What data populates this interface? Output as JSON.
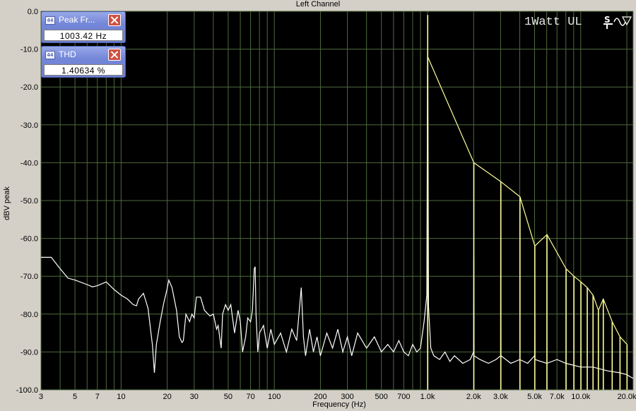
{
  "chart_data": {
    "type": "line",
    "title": "Left Channel",
    "xlabel": "Frequency (Hz)",
    "ylabel": "dBV peak",
    "x_scale": "log",
    "xlim": [
      3,
      22000
    ],
    "ylim": [
      -100,
      0
    ],
    "y_ticks": [
      0,
      -10,
      -20,
      -30,
      -40,
      -50,
      -60,
      -70,
      -80,
      -90,
      -100
    ],
    "y_tick_labels": [
      "0.0",
      "-10.0",
      "-20.0",
      "-30.0",
      "-40.0",
      "-50.0",
      "-60.0",
      "-70.0",
      "-80.0",
      "-90.0",
      "-100.0"
    ],
    "x_ticks": [
      3,
      5,
      7,
      10,
      20,
      30,
      50,
      70,
      100,
      200,
      300,
      500,
      700,
      1000,
      2000,
      3000,
      5000,
      7000,
      10000,
      20000
    ],
    "x_tick_labels": [
      "3",
      "5",
      "7",
      "10",
      "20",
      "30",
      "50",
      "70",
      "100",
      "200",
      "300",
      "500",
      "700",
      "1.0k",
      "2.0k",
      "3.0k",
      "5.0k",
      "7.0k",
      "10.0k",
      "20.0k"
    ],
    "grid": true,
    "series": [
      {
        "color": "#ffffff",
        "points": [
          [
            3,
            -65
          ],
          [
            3.5,
            -65
          ],
          [
            4,
            -68
          ],
          [
            4.5,
            -70.5
          ],
          [
            5,
            -71
          ],
          [
            6,
            -72.2
          ],
          [
            6.5,
            -72.8
          ],
          [
            7,
            -72.5
          ],
          [
            8,
            -71.5
          ],
          [
            9,
            -73.5
          ],
          [
            10,
            -75
          ],
          [
            11,
            -76
          ],
          [
            12,
            -77.5
          ],
          [
            12.6,
            -77.8
          ],
          [
            13,
            -76
          ],
          [
            14,
            -74.5
          ],
          [
            14.5,
            -76.5
          ],
          [
            15,
            -78.5
          ],
          [
            16,
            -88
          ],
          [
            16.5,
            -95.5
          ],
          [
            17,
            -88
          ],
          [
            18,
            -82
          ],
          [
            19,
            -77
          ],
          [
            19.8,
            -74
          ],
          [
            20.5,
            -71
          ],
          [
            21.5,
            -73
          ],
          [
            23,
            -79
          ],
          [
            24,
            -86
          ],
          [
            25,
            -87.5
          ],
          [
            25.5,
            -87
          ],
          [
            26.5,
            -80
          ],
          [
            28,
            -82
          ],
          [
            29,
            -80
          ],
          [
            30,
            -81
          ],
          [
            31,
            -75.5
          ],
          [
            33,
            -75.5
          ],
          [
            35,
            -79
          ],
          [
            38,
            -80.5
          ],
          [
            40,
            -80
          ],
          [
            42,
            -84
          ],
          [
            43,
            -83
          ],
          [
            45,
            -89
          ],
          [
            46,
            -80
          ],
          [
            48,
            -77.5
          ],
          [
            50,
            -79
          ],
          [
            52,
            -77.5
          ],
          [
            55,
            -85
          ],
          [
            58,
            -79
          ],
          [
            60,
            -82
          ],
          [
            62,
            -90
          ],
          [
            65,
            -86
          ],
          [
            67,
            -81
          ],
          [
            70,
            -82
          ],
          [
            72,
            -79
          ],
          [
            74,
            -68
          ],
          [
            75,
            -67.5
          ],
          [
            76,
            -80
          ],
          [
            78,
            -90
          ],
          [
            80,
            -85
          ],
          [
            85,
            -83
          ],
          [
            90,
            -89
          ],
          [
            95,
            -84
          ],
          [
            100,
            -88
          ],
          [
            110,
            -85
          ],
          [
            120,
            -90
          ],
          [
            130,
            -84
          ],
          [
            140,
            -87
          ],
          [
            150,
            -73
          ],
          [
            155,
            -86
          ],
          [
            160,
            -91
          ],
          [
            170,
            -84
          ],
          [
            180,
            -90
          ],
          [
            190,
            -86
          ],
          [
            200,
            -91
          ],
          [
            220,
            -85
          ],
          [
            240,
            -89
          ],
          [
            260,
            -84
          ],
          [
            280,
            -90
          ],
          [
            300,
            -86
          ],
          [
            320,
            -91
          ],
          [
            350,
            -85
          ],
          [
            400,
            -89
          ],
          [
            450,
            -86
          ],
          [
            500,
            -90
          ],
          [
            550,
            -88
          ],
          [
            600,
            -90
          ],
          [
            650,
            -87
          ],
          [
            700,
            -90
          ],
          [
            750,
            -91
          ],
          [
            800,
            -88
          ],
          [
            850,
            -90
          ],
          [
            900,
            -89
          ],
          [
            950,
            -82
          ],
          [
            990,
            -75
          ],
          [
            1003,
            -1
          ],
          [
            1015,
            -78
          ],
          [
            1050,
            -89
          ],
          [
            1100,
            -91
          ],
          [
            1200,
            -92
          ],
          [
            1300,
            -90
          ],
          [
            1400,
            -92.5
          ],
          [
            1500,
            -91
          ],
          [
            1700,
            -93
          ],
          [
            1900,
            -92
          ],
          [
            2000,
            -90
          ],
          [
            2006,
            -65
          ],
          [
            2012,
            -91
          ],
          [
            2200,
            -92
          ],
          [
            2500,
            -93
          ],
          [
            2800,
            -92
          ],
          [
            3000,
            -91
          ],
          [
            3010,
            -45
          ],
          [
            3020,
            -91
          ],
          [
            3500,
            -93
          ],
          [
            4000,
            -92
          ],
          [
            4500,
            -93
          ],
          [
            5000,
            -91
          ],
          [
            5015,
            -63
          ],
          [
            5030,
            -92
          ],
          [
            6000,
            -93
          ],
          [
            7000,
            -92
          ],
          [
            8000,
            -93
          ],
          [
            10000,
            -94
          ],
          [
            12000,
            -94
          ],
          [
            15000,
            -95
          ],
          [
            18000,
            -95.5
          ],
          [
            20000,
            -96
          ],
          [
            22000,
            -97
          ]
        ]
      },
      {
        "color": "#ffff99",
        "points": [
          [
            1003,
            -1
          ],
          [
            1003,
            -12
          ],
          [
            2006,
            -40
          ],
          [
            3010,
            -45
          ],
          [
            4013,
            -49
          ],
          [
            5016,
            -62
          ],
          [
            6019,
            -59
          ],
          [
            8025,
            -68
          ],
          [
            9028,
            -70
          ],
          [
            10031,
            -71.5
          ],
          [
            11034,
            -73
          ],
          [
            12037,
            -75
          ],
          [
            13040,
            -79
          ],
          [
            14043,
            -76
          ],
          [
            16049,
            -82
          ],
          [
            18055,
            -86
          ],
          [
            20061,
            -88
          ]
        ]
      }
    ]
  },
  "readouts": [
    {
      "title": "Peak Fr...",
      "value": "1003.42 Hz"
    },
    {
      "title": "THD",
      "value": "1.40634 %"
    }
  ],
  "watermark": "1Watt UL",
  "icons": {
    "readout": "meter-icon",
    "close": "close-icon",
    "generator": "signal-generator-icon"
  }
}
